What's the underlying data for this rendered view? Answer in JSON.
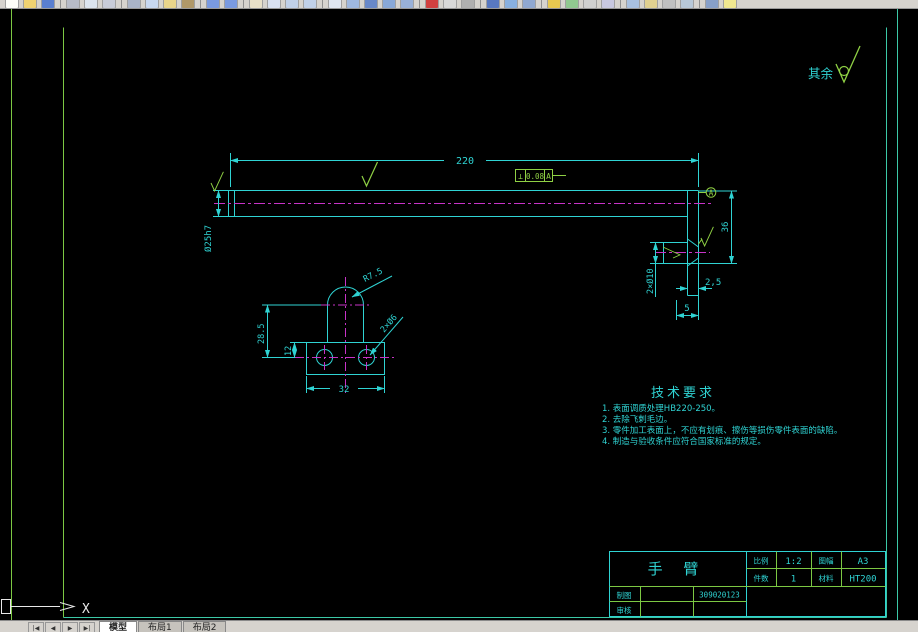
{
  "colors": {
    "line_cyan": "#2fd3d3",
    "centerline_magenta": "#c733c7",
    "symbol_green": "#8fd044",
    "frame_green": "#7cc843",
    "frame_teal": "#3cc9a7",
    "canvas": "#000000",
    "chrome": "#d6d3ce"
  },
  "toolbar": {
    "icons": [
      {
        "name": "new-icon",
        "color": "#fdfdf8"
      },
      {
        "name": "open-icon",
        "color": "#f0d372"
      },
      {
        "name": "save-icon",
        "color": "#5a7fd0"
      },
      {
        "name": "separator"
      },
      {
        "name": "plot-icon",
        "color": "#b8bcc8"
      },
      {
        "name": "plot-preview-icon",
        "color": "#dce4ee"
      },
      {
        "name": "publish-icon",
        "color": "#c8ccd8"
      },
      {
        "name": "separator"
      },
      {
        "name": "cut-icon",
        "color": "#aab4c8"
      },
      {
        "name": "copy-icon",
        "color": "#c8d8f0"
      },
      {
        "name": "paste-icon",
        "color": "#e8d48a"
      },
      {
        "name": "match-properties-icon",
        "color": "#b09868"
      },
      {
        "name": "separator"
      },
      {
        "name": "undo-icon",
        "color": "#7a9ae0"
      },
      {
        "name": "redo-icon",
        "color": "#7a9ae0"
      },
      {
        "name": "separator"
      },
      {
        "name": "pan-icon",
        "color": "#e8e0c8"
      },
      {
        "name": "zoom-realtime-icon",
        "color": "#d8e0f0"
      },
      {
        "name": "zoom-window-icon",
        "color": "#c0d0e8"
      },
      {
        "name": "zoom-previous-icon",
        "color": "#c0d0e8"
      },
      {
        "name": "separator"
      },
      {
        "name": "text-style-icon",
        "color": "#e0e6f0"
      },
      {
        "name": "dimension-style-icon",
        "color": "#9fb8e0"
      },
      {
        "name": "table-icon",
        "color": "#6888c8"
      },
      {
        "name": "layer-icon",
        "color": "#88a8d8"
      },
      {
        "name": "layer-state-icon",
        "color": "#98b0d8"
      },
      {
        "name": "separator"
      },
      {
        "name": "color-control-icon",
        "color": "#d04040"
      },
      {
        "name": "linetype-control-icon",
        "color": "#d8d8d8"
      },
      {
        "name": "lineweight-control-icon",
        "color": "#b0b0b0"
      },
      {
        "name": "separator"
      },
      {
        "name": "properties-icon",
        "color": "#5878c0"
      },
      {
        "name": "designcenter-icon",
        "color": "#88b0e0"
      },
      {
        "name": "tool-palettes-icon",
        "color": "#90a8d0"
      },
      {
        "name": "separator"
      },
      {
        "name": "measure-icon",
        "color": "#e8c850"
      },
      {
        "name": "area-icon",
        "color": "#90c890"
      },
      {
        "name": "list-icon",
        "color": "#d0d0d0"
      },
      {
        "name": "locate-point-icon",
        "color": "#c8c8e0"
      },
      {
        "name": "separator"
      },
      {
        "name": "layer-previous-icon",
        "color": "#a8c0e0"
      },
      {
        "name": "object-snap-icon",
        "color": "#e0d090"
      },
      {
        "name": "ortho-icon",
        "color": "#c0c0c0"
      },
      {
        "name": "grid-icon",
        "color": "#b8c8d8"
      },
      {
        "name": "separator"
      },
      {
        "name": "workspace-icon",
        "color": "#88a0c8"
      },
      {
        "name": "help-icon",
        "color": "#f0e890"
      }
    ]
  },
  "tabs": {
    "nav": [
      "|◀",
      "◀",
      "▶",
      "▶|"
    ],
    "items": [
      {
        "id": "model",
        "label": "模型",
        "active": true
      },
      {
        "id": "layout1",
        "label": "布局1",
        "active": false
      },
      {
        "id": "layout2",
        "label": "布局2",
        "active": false
      }
    ]
  },
  "sheet": {
    "corner_note": {
      "text": "其余"
    },
    "tech": {
      "title": "技术要求",
      "items": [
        "1. 表面调质处理HB220-250。",
        "2. 去除飞刺毛边。",
        "3. 零件加工表面上，不应有划痕、擦伤等损伤零件表面的缺陷。",
        "4. 制造与验收条件应符合国家标准的规定。"
      ]
    },
    "titleblock": {
      "part_name": "手  臂",
      "scale_label": "比例",
      "scale": "1:2",
      "size_label": "图幅",
      "size": "A3",
      "qty_label": "件数",
      "qty": "1",
      "material_label": "材料",
      "material": "HT200",
      "drawn_label": "制图",
      "checked_label": "审核",
      "doc_no": "309020123"
    },
    "dims": {
      "length": "220",
      "shaft": "Ø25h7",
      "plate_h": "36",
      "holes_side": "2×Ø10",
      "off1": "2,5",
      "off2": "5",
      "radius": "R7.5",
      "holes_front": "2×Ø6",
      "hole_off": "12",
      "center_h": "28.5",
      "base_w": "32"
    },
    "fcf": {
      "symbol": "⊥",
      "tol": "0.08",
      "datum": "A"
    },
    "datum": {
      "label": "A"
    },
    "ucs": {
      "x_label": "X"
    }
  }
}
